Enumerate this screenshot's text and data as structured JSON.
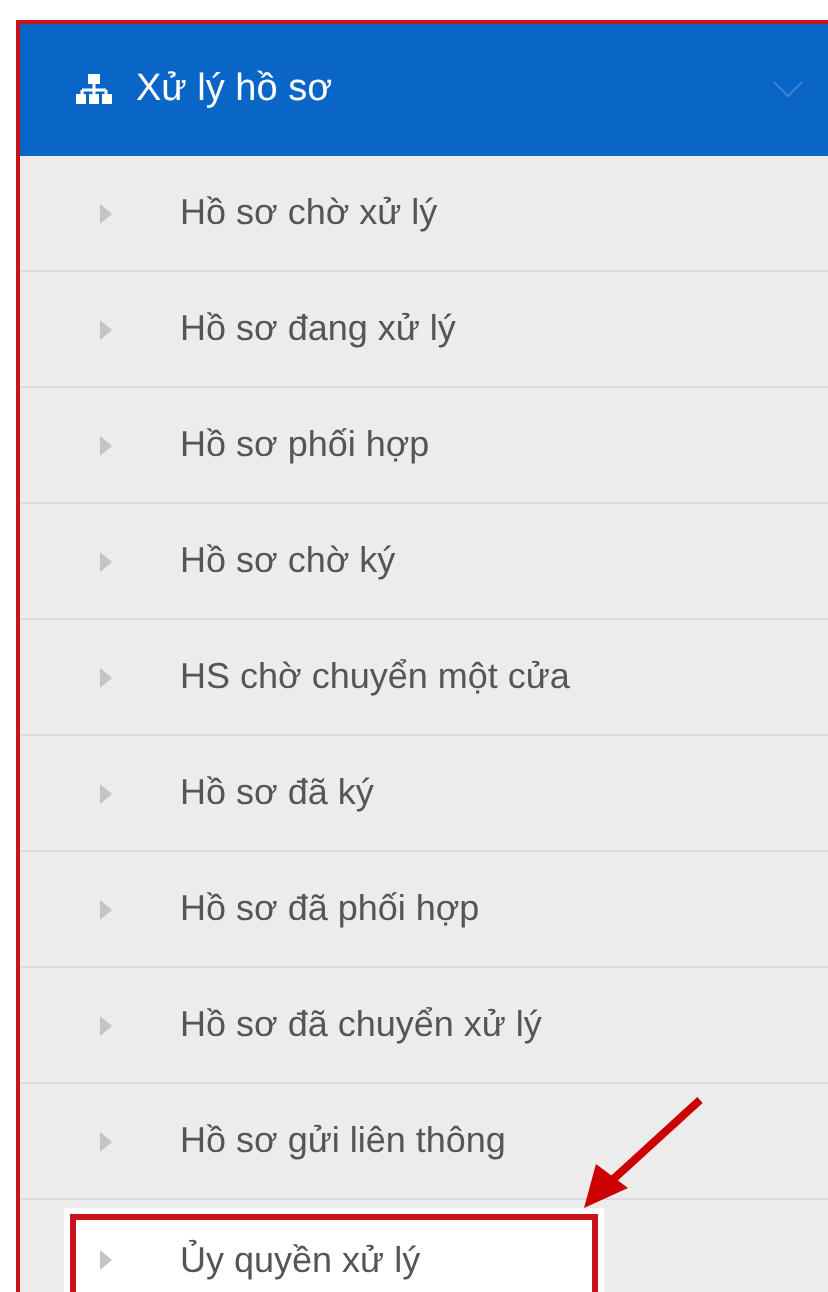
{
  "menu": {
    "title": "Xử lý hồ sơ",
    "expanded": true,
    "items": [
      {
        "label": "Hồ sơ chờ xử lý",
        "highlighted": false
      },
      {
        "label": "Hồ sơ đang xử lý",
        "highlighted": false
      },
      {
        "label": "Hồ sơ phối hợp",
        "highlighted": false
      },
      {
        "label": "Hồ sơ chờ ký",
        "highlighted": false
      },
      {
        "label": "HS chờ chuyển một cửa",
        "highlighted": false
      },
      {
        "label": "Hồ sơ đã ký",
        "highlighted": false
      },
      {
        "label": "Hồ sơ đã phối hợp",
        "highlighted": false
      },
      {
        "label": "Hồ sơ đã chuyển xử lý",
        "highlighted": false
      },
      {
        "label": "Hồ sơ gửi liên thông",
        "highlighted": false
      },
      {
        "label": "Ủy quyền xử lý",
        "highlighted": true
      }
    ]
  }
}
